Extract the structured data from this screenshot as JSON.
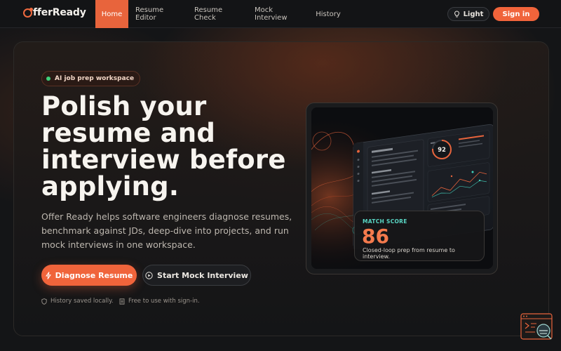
{
  "nav": {
    "logo_text": "fferReady",
    "tabs": [
      {
        "label": "Home",
        "active": true
      },
      {
        "label": "Resume Editor",
        "active": false
      },
      {
        "label": "Resume Check",
        "active": false
      },
      {
        "label": "Mock Interview",
        "active": false
      },
      {
        "label": "History",
        "active": false
      }
    ],
    "theme_label": "Light",
    "signin_label": "Sign in"
  },
  "hero": {
    "badge": "AI job prep workspace",
    "headline": "Polish your resume and interview before applying.",
    "subtext": "Offer Ready helps software engineers diagnose resumes, benchmark against JDs, deep-dive into projects, and run mock interviews in one workspace.",
    "primary_button": "Diagnose Resume",
    "secondary_button": "Start Mock Interview",
    "note_history": "History saved locally.",
    "note_free": "Free to use with sign-in."
  },
  "preview": {
    "ring_score": "92",
    "match_label": "MATCH SCORE",
    "match_value": "86",
    "match_caption": "Closed-loop prep from resume to interview."
  },
  "colors": {
    "accent": "#f0643b",
    "background": "#111315",
    "badge_dot": "#3fd07a",
    "match_label": "#59d6c4"
  },
  "icons": [
    "logo-ring-icon",
    "lightbulb-icon",
    "lightning-icon",
    "play-circle-icon",
    "shield-icon",
    "document-icon",
    "chat-widget-icon"
  ]
}
